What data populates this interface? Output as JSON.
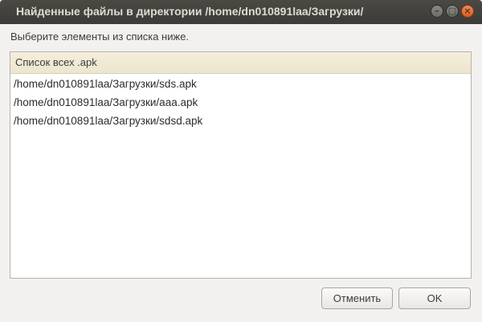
{
  "window": {
    "title": "Найденные файлы в директории /home/dn010891laa/Загрузки/",
    "controls": [
      {
        "name": "minimize-icon",
        "glyph": "–"
      },
      {
        "name": "maximize-icon",
        "glyph": "□"
      },
      {
        "name": "close-icon",
        "glyph": "×"
      }
    ]
  },
  "prompt": "Выберите элементы из списка ниже.",
  "list": {
    "header": "Список всех .apk",
    "items": [
      "/home/dn010891laa/Загрузки/sds.apk",
      "/home/dn010891laa/Загрузки/aaa.apk",
      "/home/dn010891laa/Загрузки/sdsd.apk"
    ]
  },
  "buttons": {
    "cancel": "Отменить",
    "ok": "OK"
  },
  "colors": {
    "titlebar": "#3c3b37",
    "close_button": "#e05a1a",
    "list_header": "#f0eadb"
  }
}
